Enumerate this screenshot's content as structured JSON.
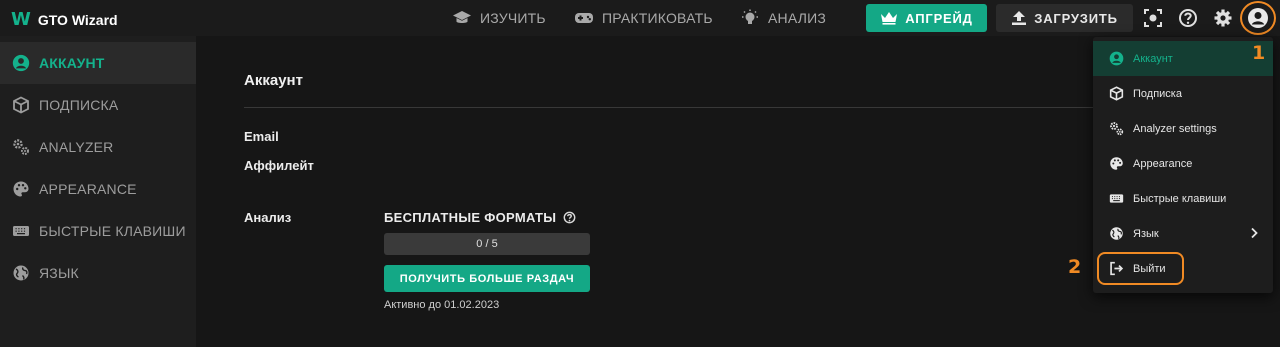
{
  "app": {
    "logo_mark": "W",
    "name": "GTO Wizard"
  },
  "nav": {
    "study": "ИЗУЧИТЬ",
    "practice": "ПРАКТИКОВАТЬ",
    "analyze": "АНАЛИЗ"
  },
  "header": {
    "upgrade_label": "АПГРЕЙД",
    "upload_label": "ЗАГРУЗИТЬ"
  },
  "sidebar": {
    "items": [
      {
        "label": "АККАУНТ",
        "icon": "user-circle-icon",
        "active": true
      },
      {
        "label": "ПОДПИСКА",
        "icon": "cube-icon"
      },
      {
        "label": "ANALYZER",
        "icon": "gears-icon"
      },
      {
        "label": "APPEARANCE",
        "icon": "palette-icon"
      },
      {
        "label": "БЫСТРЫЕ КЛАВИШИ",
        "icon": "keyboard-icon"
      },
      {
        "label": "ЯЗЫК",
        "icon": "globe-icon"
      }
    ]
  },
  "account": {
    "title": "Аккаунт",
    "email_label": "Email",
    "affiliate_label": "Аффилейт",
    "analysis_label": "Анализ",
    "free_formats_title": "БЕСПЛАТНЫЕ ФОРМАТЫ",
    "usage_text": "0 / 5",
    "usage_used": 0,
    "usage_total": 5,
    "more_hands_button": "ПОЛУЧИТЬ БОЛЬШЕ РАЗДАЧ",
    "active_until": "Активно до 01.02.2023"
  },
  "menu": {
    "items": [
      {
        "label": "Аккаунт",
        "icon": "user-circle-icon",
        "active": true
      },
      {
        "label": "Подписка",
        "icon": "cube-icon"
      },
      {
        "label": "Analyzer settings",
        "icon": "gears-icon"
      },
      {
        "label": "Appearance",
        "icon": "palette-icon"
      },
      {
        "label": "Быстрые клавиши",
        "icon": "keyboard-icon"
      },
      {
        "label": "Язык",
        "icon": "globe-icon"
      },
      {
        "label": "Выйти",
        "icon": "logout-icon"
      }
    ]
  },
  "annotations": {
    "step1": "1",
    "step2": "2"
  },
  "colors": {
    "accent": "#14a886",
    "annotation": "#f08a24",
    "background": "#151515",
    "sidebar_bg": "#1e1e1e"
  }
}
